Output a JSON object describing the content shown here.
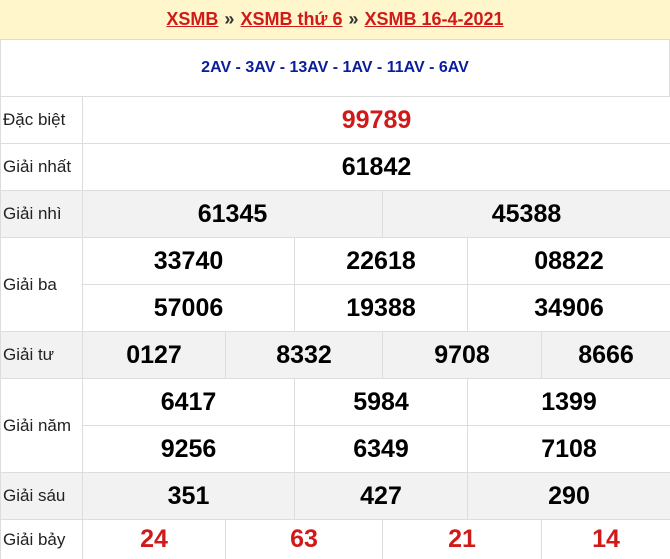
{
  "breadcrumb": {
    "link1": "XSMB",
    "sep1": "»",
    "link2": "XSMB thứ 6",
    "sep2": "»",
    "link3": "XSMB 16-4-2021"
  },
  "codes": "2AV - 3AV - 13AV - 1AV - 11AV - 6AV",
  "prizes": {
    "special": {
      "label": "Đặc biệt",
      "numbers": [
        "99789"
      ]
    },
    "first": {
      "label": "Giải nhất",
      "numbers": [
        "61842"
      ]
    },
    "second": {
      "label": "Giải nhì",
      "numbers": [
        "61345",
        "45388"
      ]
    },
    "third": {
      "label": "Giải ba",
      "numbers": [
        "33740",
        "22618",
        "08822",
        "57006",
        "19388",
        "34906"
      ]
    },
    "fourth": {
      "label": "Giải tư",
      "numbers": [
        "0127",
        "8332",
        "9708",
        "8666"
      ]
    },
    "fifth": {
      "label": "Giải năm",
      "numbers": [
        "6417",
        "5984",
        "1399",
        "9256",
        "6349",
        "7108"
      ]
    },
    "sixth": {
      "label": "Giải sáu",
      "numbers": [
        "351",
        "427",
        "290"
      ]
    },
    "seventh": {
      "label": "Giải bảy",
      "numbers": [
        "24",
        "63",
        "21",
        "14"
      ]
    }
  },
  "colors": {
    "accent_red": "#d01a1a",
    "code_blue": "#0a1e9c",
    "header_bg": "#fff6cc",
    "row_shade": "#f2f2f2"
  }
}
